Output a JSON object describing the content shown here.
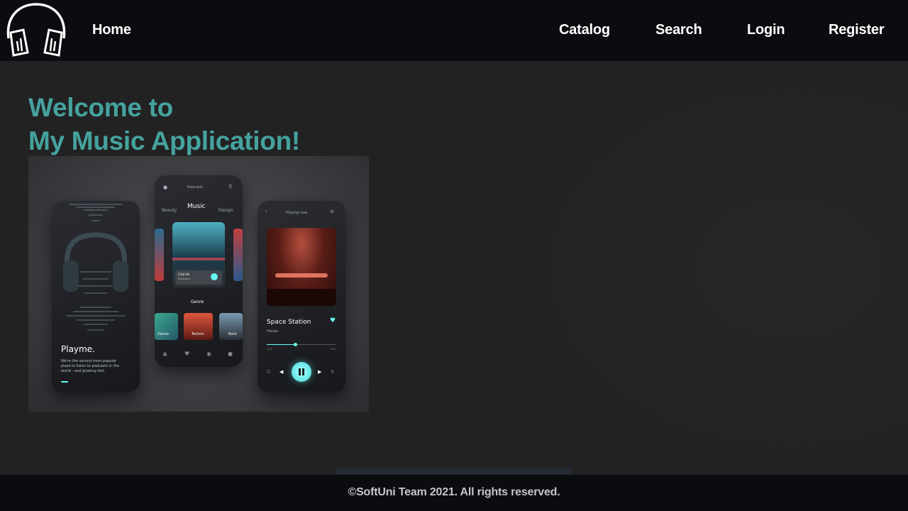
{
  "nav": {
    "home": "Home",
    "catalog": "Catalog",
    "search": "Search",
    "login": "Login",
    "register": "Register"
  },
  "hero": {
    "title_line1": "Welcome to",
    "title_line2": "My Music Application!"
  },
  "mockup": {
    "phone1": {
      "brand": "Playme.",
      "tagline": [
        "We're the second most popular",
        "place to listen to podcasts in the",
        "world - and growing fast."
      ]
    },
    "phone2": {
      "header": "Podcasts",
      "tabs": [
        "Beauty",
        "Music",
        "Design"
      ],
      "card_title": "Club life",
      "card_subtitle": "Electronic",
      "genre_label": "Genre",
      "genres": [
        "Dance",
        "Techno",
        "Rock"
      ]
    },
    "phone3": {
      "header": "Playing now",
      "track": "Space Station",
      "artist": "House",
      "time_start": "1:21",
      "time_end": "3:47"
    }
  },
  "footer": {
    "text": "©SoftUni Team 2021. All rights reserved."
  },
  "colors": {
    "accent": "#45a29e",
    "navbar_bg": "#0b0c10",
    "page_bg": "#222223",
    "player_accent": "#66fcf1"
  }
}
